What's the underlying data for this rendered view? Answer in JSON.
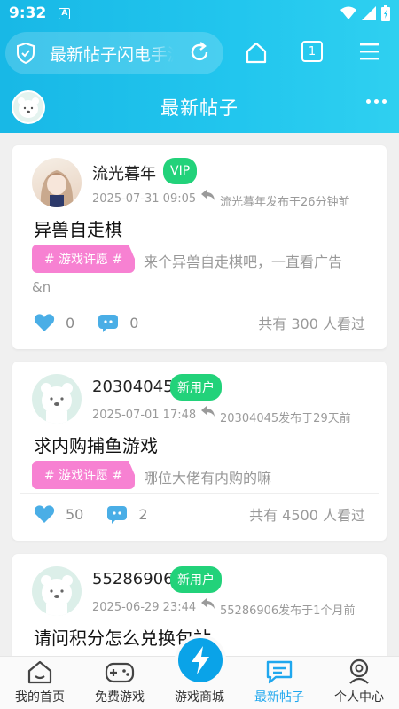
{
  "status": {
    "time": "9:32",
    "notif_letter": "A"
  },
  "browser": {
    "url_text": "最新帖子闪电手游",
    "tab_count": "1"
  },
  "header": {
    "title": "最新帖子"
  },
  "posts": [
    {
      "username": "流光暮年",
      "badge": "VIP",
      "date": "2025-07-31 09:05",
      "meta": "流光暮年发布于26分钟前",
      "title": "异兽自走棋",
      "tag": "# 游戏许愿 #",
      "excerpt": "来个异兽自走棋吧，一直看广告",
      "excerpt_cont": "&n",
      "likes": "0",
      "comments": "0",
      "views": "共有 300 人看过"
    },
    {
      "username": "20304045",
      "badge": "新用户",
      "date": "2025-07-01 17:48",
      "meta": "20304045发布于29天前",
      "title": "求内购捕鱼游戏",
      "tag": "# 游戏许愿 #",
      "excerpt": "哪位大佬有内购的嘛",
      "likes": "50",
      "comments": "2",
      "views": "共有 4500 人看过"
    },
    {
      "username": "55286906",
      "badge": "新用户",
      "date": "2025-06-29 23:44",
      "meta": "55286906发布于1个月前",
      "title": "请问积分怎么兑换包站"
    }
  ],
  "nav": [
    {
      "label": "我的首页",
      "icon": "home-icon"
    },
    {
      "label": "免费游戏",
      "icon": "gamepad-icon"
    },
    {
      "label": "游戏商城",
      "icon": "lightning-icon"
    },
    {
      "label": "最新帖子",
      "icon": "chat-icon",
      "active": true
    },
    {
      "label": "个人中心",
      "icon": "user-icon"
    }
  ],
  "colors": {
    "accent": "#1fa7ee",
    "badge_green": "#22d27a",
    "tag_pink": "#f781d2",
    "like_blue": "#4aaee6"
  }
}
